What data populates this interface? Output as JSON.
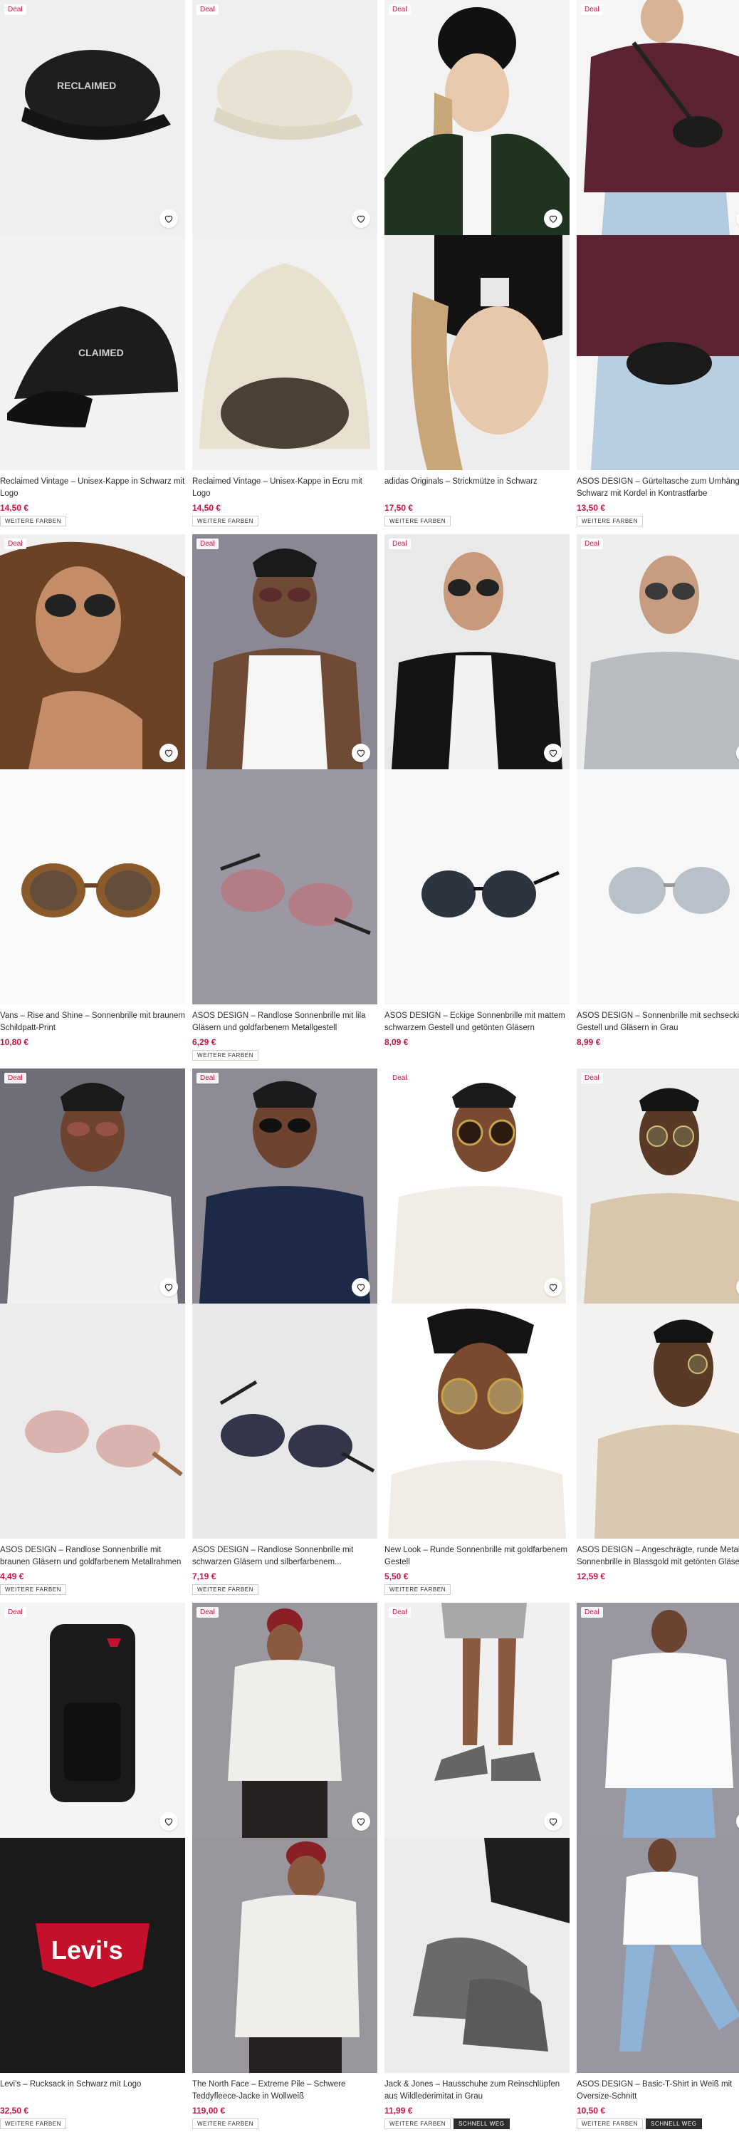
{
  "deal_label": "Deal",
  "colors": {
    "price": "#d01345",
    "deal": "#d01345"
  },
  "products": [
    {
      "title": "Reclaimed Vintage – Unisex-Kappe in Schwarz mit Logo",
      "price": "14,50 €",
      "tags": [
        "WEITERE FARBEN"
      ]
    },
    {
      "title": "Reclaimed Vintage – Unisex-Kappe in Ecru mit Logo",
      "price": "14,50 €",
      "tags": [
        "WEITERE FARBEN"
      ]
    },
    {
      "title": "adidas Originals – Strickmütze in Schwarz",
      "price": "17,50 €",
      "tags": [
        "WEITERE FARBEN"
      ]
    },
    {
      "title": "ASOS DESIGN – Gürteltasche zum Umhängen in Schwarz mit Kordel in Kontrastfarbe",
      "price": "13,50 €",
      "tags": [
        "WEITERE FARBEN"
      ]
    },
    {
      "title": "Vans – Rise and Shine – Sonnenbrille mit braunem Schildpatt-Print",
      "price": "10,80 €",
      "tags": []
    },
    {
      "title": "ASOS DESIGN – Randlose Sonnenbrille mit lila Gläsern und goldfarbenem Metallgestell",
      "price": "6,29 €",
      "tags": [
        "WEITERE FARBEN"
      ]
    },
    {
      "title": "ASOS DESIGN – Eckige Sonnenbrille mit mattem schwarzem Gestell und getönten Gläsern",
      "price": "8,09 €",
      "tags": []
    },
    {
      "title": "ASOS DESIGN – Sonnenbrille mit sechseckigem Gestell und Gläsern in Grau",
      "price": "8,99 €",
      "tags": []
    },
    {
      "title": "ASOS DESIGN – Randlose Sonnenbrille mit braunen Gläsern und goldfarbenem Metallrahmen",
      "price": "4,49 €",
      "tags": [
        "WEITERE FARBEN"
      ]
    },
    {
      "title": "ASOS DESIGN – Randlose Sonnenbrille mit schwarzen Gläsern und silberfarbenem...",
      "price": "7,19 €",
      "tags": [
        "WEITERE FARBEN"
      ]
    },
    {
      "title": "New Look – Runde Sonnenbrille mit goldfarbenem Gestell",
      "price": "5,50 €",
      "tags": [
        "WEITERE FARBEN"
      ]
    },
    {
      "title": "ASOS DESIGN – Angeschrägte, runde Metall-Sonnenbrille in Blassgold mit getönten Gläsern",
      "price": "12,59 €",
      "tags": []
    },
    {
      "title": "Levi's – Rucksack in Schwarz mit Logo",
      "price": "32,50 €",
      "tags": [
        "WEITERE FARBEN"
      ]
    },
    {
      "title": "The North Face – Extreme Pile – Schwere Teddyfleece-Jacke in Wollweiß",
      "price": "119,00 €",
      "tags": [
        "WEITERE FARBEN"
      ]
    },
    {
      "title": "Jack & Jones – Hausschuhe zum Reinschlüpfen aus Wildlederimitat in Grau",
      "price": "11,99 €",
      "tags": [
        "WEITERE FARBEN",
        "SCHNELL WEG"
      ]
    },
    {
      "title": "ASOS DESIGN – Basic-T-Shirt in Weiß mit Oversize-Schnitt",
      "price": "10,50 €",
      "tags": [
        "WEITERE FARBEN",
        "SCHNELL WEG"
      ]
    }
  ]
}
